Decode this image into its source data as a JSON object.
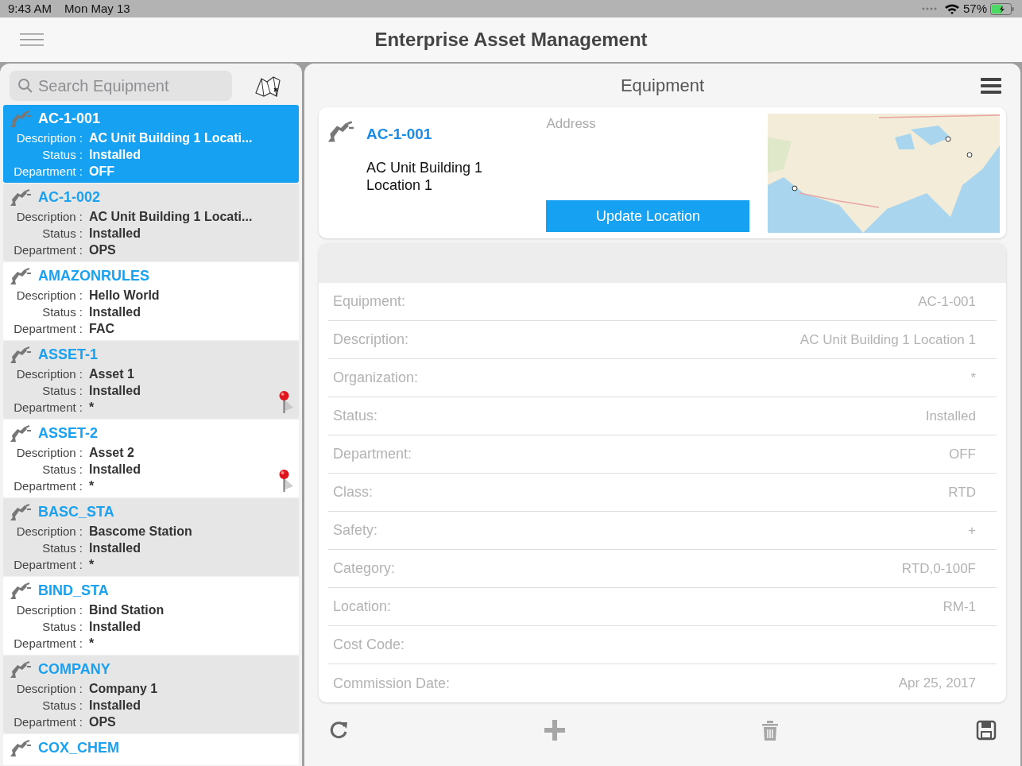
{
  "status_bar": {
    "time": "9:43 AM",
    "date": "Mon May 13",
    "battery": "57%"
  },
  "app": {
    "title": "Enterprise Asset Management"
  },
  "search": {
    "placeholder": "Search Equipment"
  },
  "equipment_list": [
    {
      "name": "AC-1-001",
      "fields": [
        {
          "label": "Description :",
          "value": "AC Unit Building 1 Locati..."
        },
        {
          "label": "Status :",
          "value": "Installed"
        },
        {
          "label": "Department :",
          "value": "OFF"
        }
      ],
      "selected": true,
      "pinned": false
    },
    {
      "name": "AC-1-002",
      "fields": [
        {
          "label": "Description :",
          "value": "AC Unit Building 1 Locati..."
        },
        {
          "label": "Status :",
          "value": "Installed"
        },
        {
          "label": "Department :",
          "value": "OPS"
        }
      ],
      "selected": false,
      "pinned": false
    },
    {
      "name": "AMAZONRULES",
      "fields": [
        {
          "label": "Description :",
          "value": "Hello World"
        },
        {
          "label": "Status :",
          "value": "Installed"
        },
        {
          "label": "Department :",
          "value": "FAC"
        }
      ],
      "selected": false,
      "pinned": false
    },
    {
      "name": "ASSET-1",
      "fields": [
        {
          "label": "Description :",
          "value": "Asset 1"
        },
        {
          "label": "Status :",
          "value": "Installed"
        },
        {
          "label": "Department :",
          "value": "*"
        }
      ],
      "selected": false,
      "pinned": true
    },
    {
      "name": "ASSET-2",
      "fields": [
        {
          "label": "Description :",
          "value": "Asset 2"
        },
        {
          "label": "Status :",
          "value": "Installed"
        },
        {
          "label": "Department :",
          "value": "*"
        }
      ],
      "selected": false,
      "pinned": true
    },
    {
      "name": "BASC_STA",
      "fields": [
        {
          "label": "Description :",
          "value": "Bascome Station"
        },
        {
          "label": "Status :",
          "value": "Installed"
        },
        {
          "label": "Department :",
          "value": "*"
        }
      ],
      "selected": false,
      "pinned": false
    },
    {
      "name": "BIND_STA",
      "fields": [
        {
          "label": "Description :",
          "value": "Bind Station"
        },
        {
          "label": "Status :",
          "value": "Installed"
        },
        {
          "label": "Department :",
          "value": "*"
        }
      ],
      "selected": false,
      "pinned": false
    },
    {
      "name": "COMPANY",
      "fields": [
        {
          "label": "Description :",
          "value": "Company 1"
        },
        {
          "label": "Status :",
          "value": "Installed"
        },
        {
          "label": "Department :",
          "value": "OPS"
        }
      ],
      "selected": false,
      "pinned": false
    },
    {
      "name": "COX_CHEM",
      "selected": false,
      "pinned": false
    }
  ],
  "detail": {
    "title": "Equipment",
    "summary": {
      "code": "AC-1-001",
      "description": "AC Unit Building 1 Location 1",
      "address_label": "Address",
      "button": "Update Location"
    },
    "fields": [
      {
        "label": "Equipment:",
        "value": "AC-1-001"
      },
      {
        "label": "Description:",
        "value": "AC Unit Building 1 Location 1"
      },
      {
        "label": "Organization:",
        "value": "*"
      },
      {
        "label": "Status:",
        "value": "Installed"
      },
      {
        "label": "Department:",
        "value": "OFF"
      },
      {
        "label": "Class:",
        "value": "RTD"
      },
      {
        "label": "Safety:",
        "value": "+"
      },
      {
        "label": "Category:",
        "value": "RTD,0-100F"
      },
      {
        "label": "Location:",
        "value": "RM-1"
      },
      {
        "label": "Cost Code:"
      },
      {
        "label": "Commission Date:",
        "value": "Apr 25, 2017"
      }
    ],
    "toolbar": [
      {
        "kind": "refresh",
        "disabled": false
      },
      {
        "kind": "add",
        "disabled": true
      },
      {
        "kind": "delete",
        "disabled": true
      },
      {
        "kind": "save",
        "disabled": false
      }
    ]
  }
}
